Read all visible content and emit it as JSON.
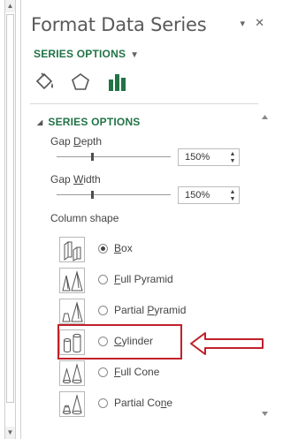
{
  "pane": {
    "title": "Format Data Series",
    "menu_caret": "▾",
    "close": "✕"
  },
  "series_dropdown": {
    "label": "SERIES OPTIONS",
    "caret": "▼"
  },
  "tabs": [
    {
      "name": "fill-line",
      "icon": "paint-bucket-icon"
    },
    {
      "name": "effects",
      "icon": "pentagon-icon"
    },
    {
      "name": "series-options",
      "icon": "column-chart-icon"
    }
  ],
  "section": {
    "toggle": "◢",
    "label": "SERIES OPTIONS"
  },
  "gap_depth": {
    "label_pre": "Gap ",
    "label_key": "D",
    "label_post": "epth",
    "value": "150%",
    "slider_fraction": 0.3
  },
  "gap_width": {
    "label_pre": "Gap ",
    "label_key": "W",
    "label_post": "idth",
    "value": "150%",
    "slider_fraction": 0.3
  },
  "column_shape": {
    "label": "Column shape"
  },
  "shapes": [
    {
      "key": "B",
      "rest": "ox",
      "checked": true,
      "icon": "box-shape-icon"
    },
    {
      "key": "F",
      "rest": "ull Pyramid",
      "checked": false,
      "icon": "full-pyramid-icon"
    },
    {
      "pre": "Partial ",
      "key": "P",
      "rest": "yramid",
      "checked": false,
      "icon": "partial-pyramid-icon"
    },
    {
      "key": "C",
      "rest": "ylinder",
      "checked": false,
      "icon": "cylinder-icon"
    },
    {
      "key": "F",
      "rest": "ull Cone",
      "checked": false,
      "icon": "full-cone-icon"
    },
    {
      "pre": "Partial Co",
      "key": "n",
      "rest": "e",
      "checked": false,
      "icon": "partial-cone-icon"
    }
  ],
  "colors": {
    "accent": "#217346",
    "highlight": "#c0202a",
    "arrow": "#c0202a"
  }
}
